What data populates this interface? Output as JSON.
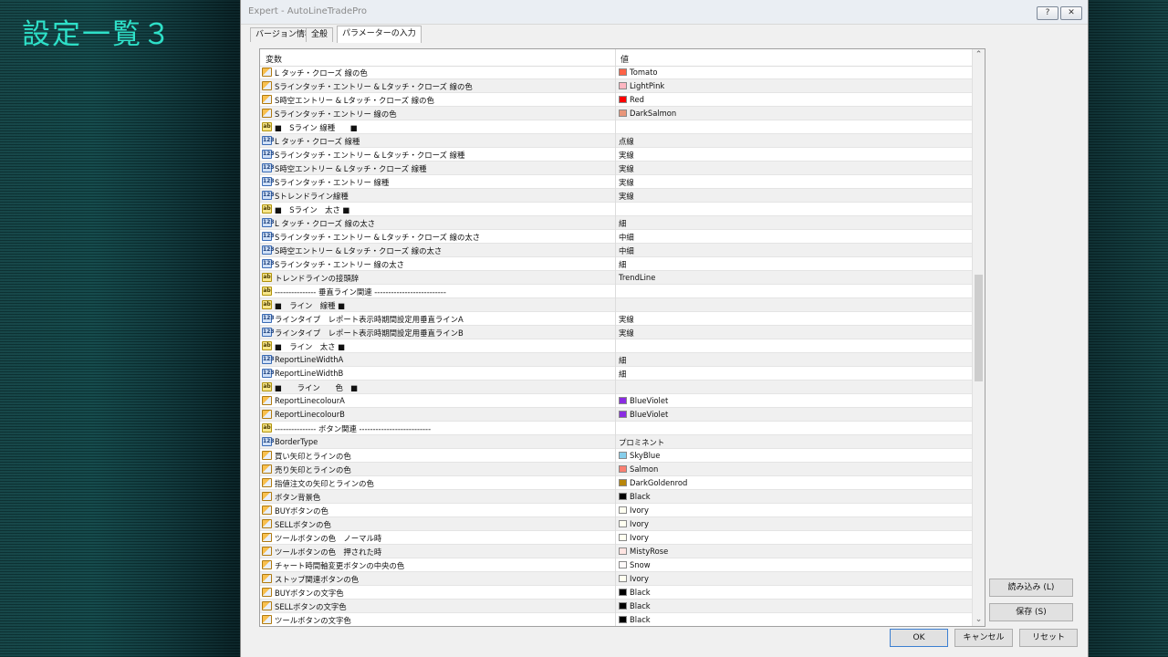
{
  "slide_title": "設定一覧３",
  "window": {
    "title": "Expert - AutoLineTradePro",
    "help_btn": "?",
    "close_btn": "✕"
  },
  "tabs": [
    "バージョン情報",
    "全般",
    "パラメーターの入力"
  ],
  "grid": {
    "col_variable": "変数",
    "col_value": "値",
    "rows": [
      {
        "icon": "color",
        "name": "L タッチ・クローズ 線の色",
        "value": "Tomato",
        "swatch": "#ff6347"
      },
      {
        "icon": "color",
        "name": "Sラインタッチ・エントリー & Lタッチ・クローズ 線の色",
        "value": "LightPink",
        "swatch": "#ffb6c1"
      },
      {
        "icon": "color",
        "name": "S時空エントリー & Lタッチ・クローズ 線の色",
        "value": "Red",
        "swatch": "#ff0000"
      },
      {
        "icon": "color",
        "name": "Sラインタッチ・エントリー 線の色",
        "value": "DarkSalmon",
        "swatch": "#e9967a"
      },
      {
        "icon": "str",
        "name": "■　Sライン 線種　　■",
        "value": ""
      },
      {
        "icon": "enum",
        "name": "L タッチ・クローズ 線種",
        "value": "点線"
      },
      {
        "icon": "enum",
        "name": "Sラインタッチ・エントリー & Lタッチ・クローズ 線種",
        "value": "実線"
      },
      {
        "icon": "enum",
        "name": "S時空エントリー & Lタッチ・クローズ 線種",
        "value": "実線"
      },
      {
        "icon": "enum",
        "name": "Sラインタッチ・エントリー 線種",
        "value": "実線"
      },
      {
        "icon": "enum",
        "name": "Sトレンドライン線種",
        "value": "実線"
      },
      {
        "icon": "str",
        "name": "■　Sライン　太さ ■",
        "value": ""
      },
      {
        "icon": "enum",
        "name": "L タッチ・クローズ 線の太さ",
        "value": "細"
      },
      {
        "icon": "enum",
        "name": "Sラインタッチ・エントリー & Lタッチ・クローズ 線の太さ",
        "value": "中細"
      },
      {
        "icon": "enum",
        "name": "S時空エントリー & Lタッチ・クローズ 線の太さ",
        "value": "中細"
      },
      {
        "icon": "enum",
        "name": "Sラインタッチ・エントリー 線の太さ",
        "value": "細"
      },
      {
        "icon": "str",
        "name": "トレンドラインの接頭辞",
        "value": "TrendLine"
      },
      {
        "icon": "str",
        "name": "--------------- 垂直ライン関連 --------------------------",
        "value": ""
      },
      {
        "icon": "str",
        "name": "■　ライン　線種 ■",
        "value": ""
      },
      {
        "icon": "enum",
        "name": "ラインタイプ　レポート表示時期間設定用垂直ラインA",
        "value": "実線"
      },
      {
        "icon": "enum",
        "name": "ラインタイプ　レポート表示時期間設定用垂直ラインB",
        "value": "実線"
      },
      {
        "icon": "str",
        "name": "■　ライン　太さ ■",
        "value": ""
      },
      {
        "icon": "enum",
        "name": "ReportLineWidthA",
        "value": "細"
      },
      {
        "icon": "enum",
        "name": "ReportLineWidthB",
        "value": "細"
      },
      {
        "icon": "str",
        "name": "■　　ライン　　色　■",
        "value": ""
      },
      {
        "icon": "color",
        "name": "ReportLinecolourA",
        "value": "BlueViolet",
        "swatch": "#8a2be2"
      },
      {
        "icon": "color",
        "name": "ReportLinecolourB",
        "value": "BlueViolet",
        "swatch": "#8a2be2"
      },
      {
        "icon": "str",
        "name": "--------------- ボタン関連 --------------------------",
        "value": ""
      },
      {
        "icon": "enum",
        "name": "BorderType",
        "value": "プロミネント"
      },
      {
        "icon": "color",
        "name": "買い矢印とラインの色",
        "value": "SkyBlue",
        "swatch": "#87ceeb"
      },
      {
        "icon": "color",
        "name": "売り矢印とラインの色",
        "value": "Salmon",
        "swatch": "#fa8072"
      },
      {
        "icon": "color",
        "name": "指値注文の矢印とラインの色",
        "value": "DarkGoldenrod",
        "swatch": "#b8860b"
      },
      {
        "icon": "color",
        "name": "ボタン背景色",
        "value": "Black",
        "swatch": "#000000"
      },
      {
        "icon": "color",
        "name": "BUYボタンの色",
        "value": "Ivory",
        "swatch": "#fffff0"
      },
      {
        "icon": "color",
        "name": "SELLボタンの色",
        "value": "Ivory",
        "swatch": "#fffff0"
      },
      {
        "icon": "color",
        "name": "ツールボタンの色　ノーマル時",
        "value": "Ivory",
        "swatch": "#fffff0"
      },
      {
        "icon": "color",
        "name": "ツールボタンの色　押された時",
        "value": "MistyRose",
        "swatch": "#ffe4e1"
      },
      {
        "icon": "color",
        "name": "チャート時間軸変更ボタンの中央の色",
        "value": "Snow",
        "swatch": "#fffafa"
      },
      {
        "icon": "color",
        "name": "ストップ関連ボタンの色",
        "value": "Ivory",
        "swatch": "#fffff0"
      },
      {
        "icon": "color",
        "name": "BUYボタンの文字色",
        "value": "Black",
        "swatch": "#000000"
      },
      {
        "icon": "color",
        "name": "SELLボタンの文字色",
        "value": "Black",
        "swatch": "#000000"
      },
      {
        "icon": "color",
        "name": "ツールボタンの文字色",
        "value": "Black",
        "swatch": "#000000"
      }
    ]
  },
  "buttons": {
    "load": "読み込み (L)",
    "save": "保存 (S)",
    "ok": "OK",
    "cancel": "キャンセル",
    "reset": "リセット"
  }
}
